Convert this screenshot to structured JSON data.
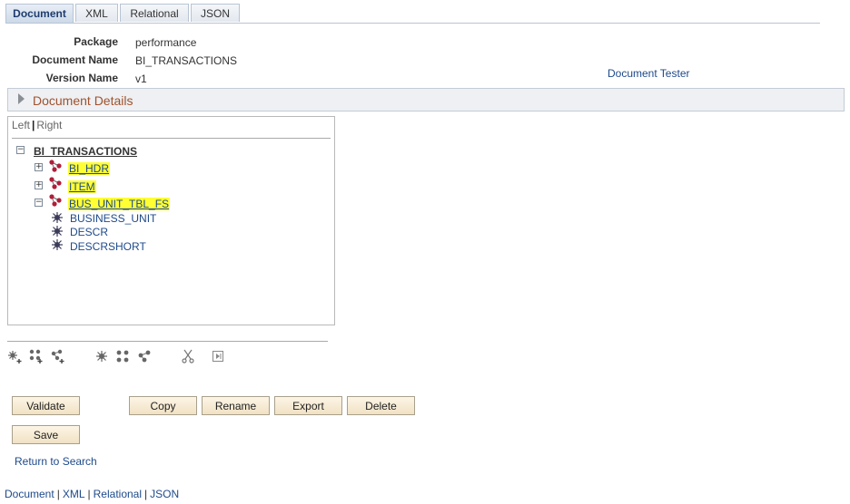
{
  "tabs": [
    {
      "label": "Document",
      "active": true
    },
    {
      "label": "XML",
      "active": false
    },
    {
      "label": "Relational",
      "active": false
    },
    {
      "label": "JSON",
      "active": false
    }
  ],
  "fields": {
    "package_label": "Package",
    "package_value": "performance",
    "docname_label": "Document Name",
    "docname_value": "BI_TRANSACTIONS",
    "version_label": "Version Name",
    "version_value": "v1"
  },
  "document_tester": "Document Tester",
  "details_label": "Document Details",
  "view_toggle": {
    "left": "Left",
    "right": "Right"
  },
  "tree": {
    "root": "BI_TRANSACTIONS",
    "records": [
      "BI_HDR",
      "ITEM",
      "BUS_UNIT_TBL_FS"
    ],
    "fields": [
      "BUSINESS_UNIT",
      "DESCR",
      "DESCRSHORT"
    ]
  },
  "toolbar_icons": [
    "add-primitive-icon",
    "add-compound-icon",
    "add-collection-icon",
    "primitive-icon",
    "compound-icon",
    "collection-icon",
    "cut-icon",
    "paste-icon"
  ],
  "buttons": {
    "validate": "Validate",
    "copy": "Copy",
    "rename": "Rename",
    "export": "Export",
    "delete": "Delete",
    "save": "Save"
  },
  "return_link": "Return to Search",
  "bottom_nav": [
    "Document",
    "XML",
    "Relational",
    "JSON"
  ],
  "colors": {
    "record_highlight": "#ffff33",
    "link": "#1e4a8a",
    "details_text": "#a0522d"
  }
}
